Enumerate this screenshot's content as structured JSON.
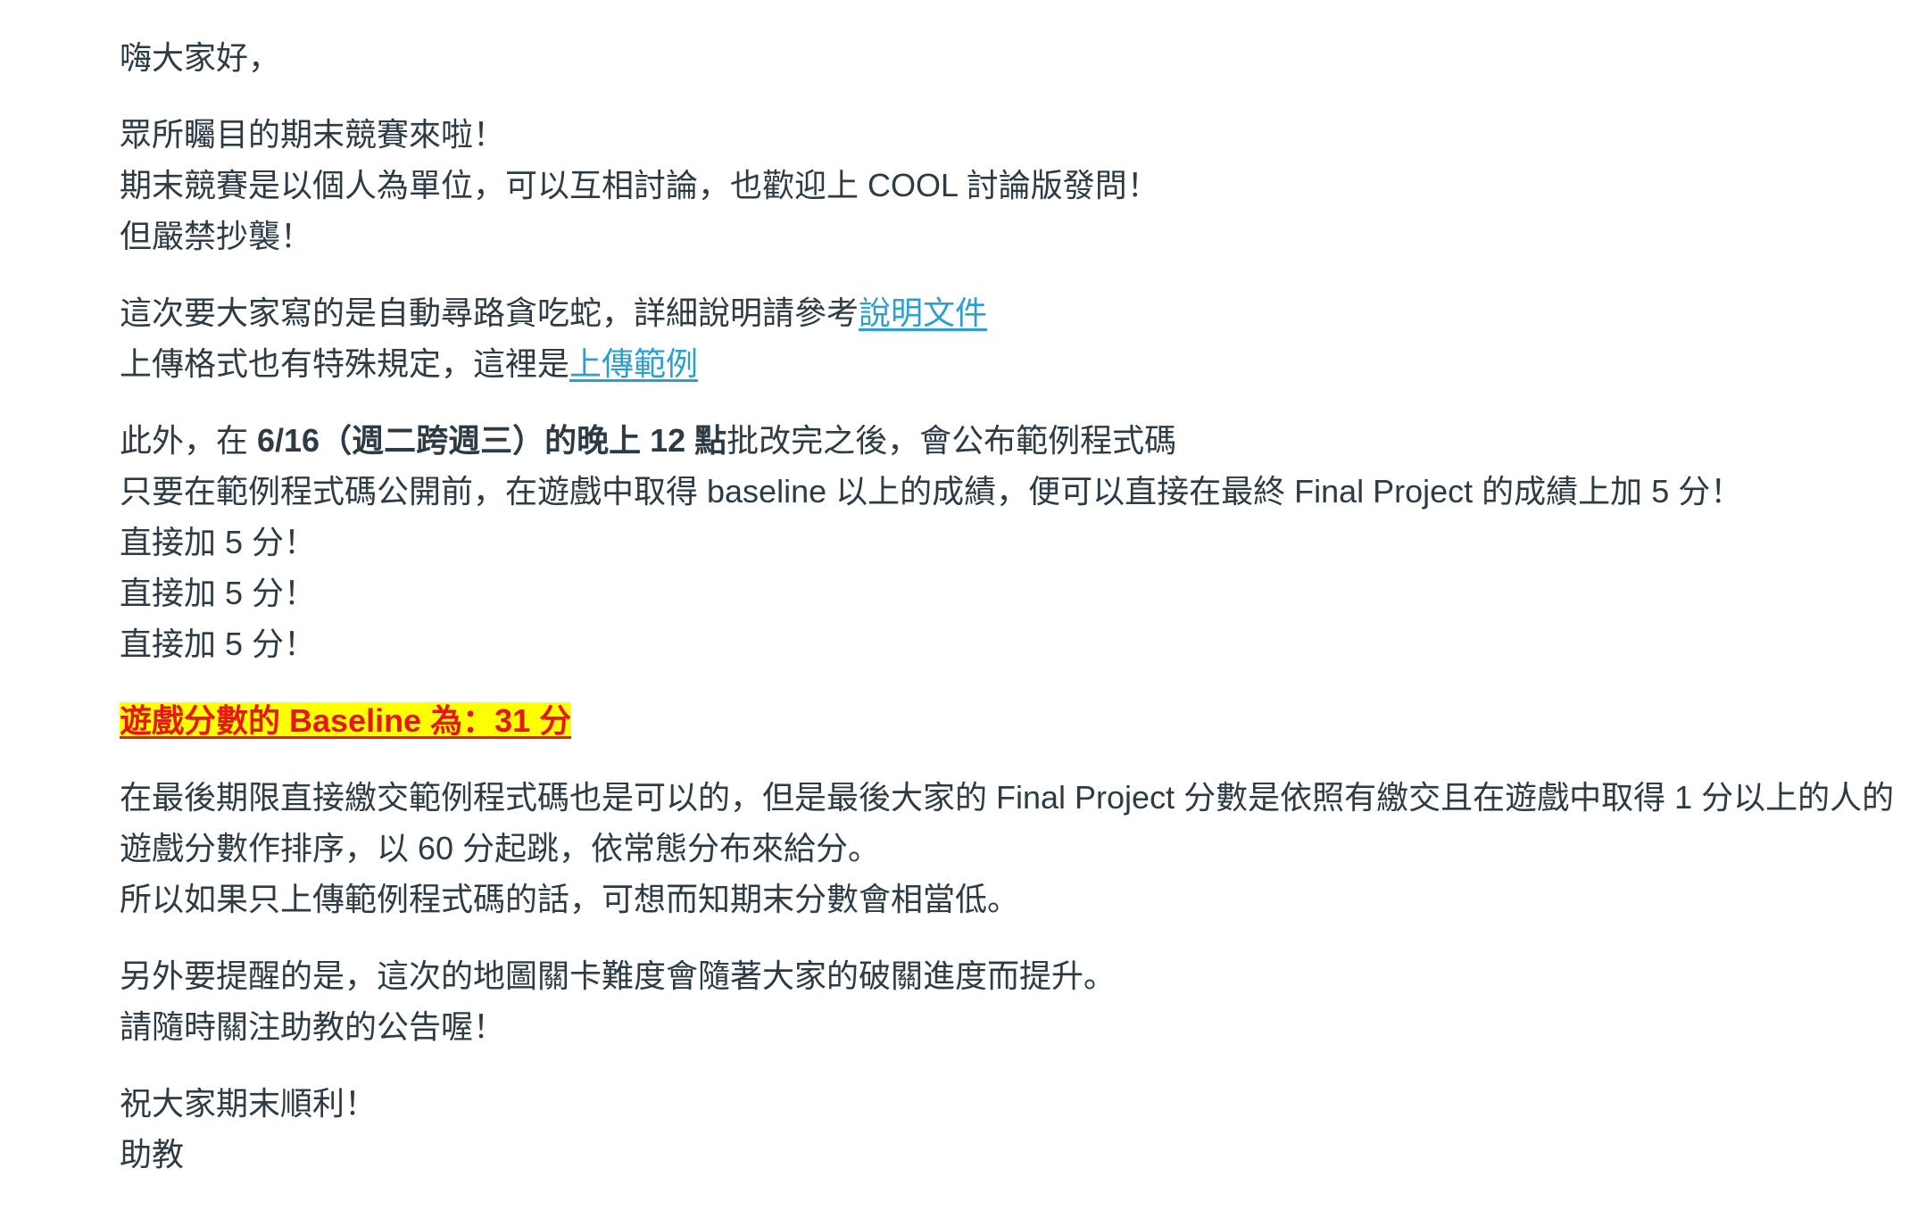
{
  "post": {
    "greeting": "嗨大家好，",
    "intro": {
      "line1": "眾所矚目的期末競賽來啦！",
      "line2": "期末競賽是以個人為單位，可以互相討論，也歡迎上 COOL 討論版發問！",
      "line3": "但嚴禁抄襲！"
    },
    "task": {
      "line1_text": "這次要大家寫的是自動尋路貪吃蛇，詳細說明請參考",
      "doc_link": "說明文件",
      "line2_text": "上傳格式也有特殊規定，這裡是",
      "upload_link": "上傳範例"
    },
    "bonus": {
      "line1_pre": "此外，在 ",
      "line1_bold": "6/16（週二跨週三）的晚上 12 點",
      "line1_post": "批改完之後，會公布範例程式碼",
      "line2": "只要在範例程式碼公開前，在遊戲中取得 baseline 以上的成績，便可以直接在最終 Final Project 的成績上加 5 分！",
      "repeat1": "直接加 5 分！",
      "repeat2": "直接加 5 分！",
      "repeat3": "直接加 5 分！"
    },
    "baseline": "遊戲分數的 Baseline 為：31 分",
    "grading": {
      "line1": "在最後期限直接繳交範例程式碼也是可以的，但是最後大家的 Final Project 分數是依照有繳交且在遊戲中取得 1 分以上的人的遊戲分數作排序，以 60 分起跳，依常態分布來給分。",
      "line2": "所以如果只上傳範例程式碼的話，可想而知期末分數會相當低。"
    },
    "reminder": {
      "line1": "另外要提醒的是，這次的地圖關卡難度會隨著大家的破關進度而提升。",
      "line2": "請隨時關注助教的公告喔！"
    },
    "closing": {
      "line1": "祝大家期末順利！",
      "line2": "助教"
    }
  },
  "colors": {
    "text": "#2d3b45",
    "link": "#2b9fd0",
    "highlight_bg": "#ffff00",
    "highlight_text": "#e8161b"
  }
}
